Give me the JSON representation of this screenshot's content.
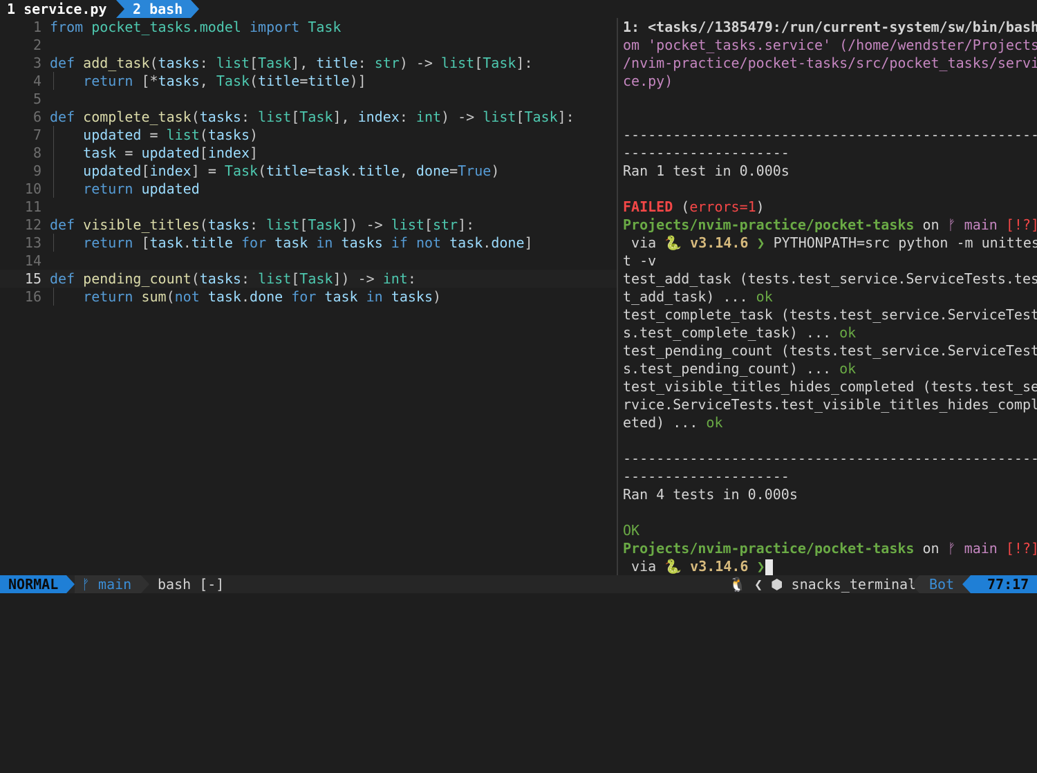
{
  "tabs": [
    {
      "label": "1 service.py"
    },
    {
      "label": "2 bash"
    }
  ],
  "editor": {
    "lines": [
      {
        "num": "1",
        "tokens": [
          [
            "kw",
            "from"
          ],
          [
            "op",
            " "
          ],
          [
            "mod",
            "pocket_tasks.model"
          ],
          [
            "op",
            " "
          ],
          [
            "kw",
            "import"
          ],
          [
            "op",
            " "
          ],
          [
            "ty",
            "Task"
          ]
        ]
      },
      {
        "num": "2",
        "tokens": []
      },
      {
        "num": "3",
        "tokens": [
          [
            "kw",
            "def"
          ],
          [
            "op",
            " "
          ],
          [
            "fn",
            "add_task"
          ],
          [
            "pu",
            "("
          ],
          [
            "va",
            "tasks"
          ],
          [
            "pu",
            ": "
          ],
          [
            "ty",
            "list"
          ],
          [
            "pu",
            "["
          ],
          [
            "ty",
            "Task"
          ],
          [
            "pu",
            "], "
          ],
          [
            "va",
            "title"
          ],
          [
            "pu",
            ": "
          ],
          [
            "ty",
            "str"
          ],
          [
            "pu",
            ") -> "
          ],
          [
            "ty",
            "list"
          ],
          [
            "pu",
            "["
          ],
          [
            "ty",
            "Task"
          ],
          [
            "pu",
            "]:"
          ]
        ]
      },
      {
        "num": "4",
        "guide": true,
        "tokens": [
          [
            "op",
            "    "
          ],
          [
            "kw",
            "return"
          ],
          [
            "op",
            " "
          ],
          [
            "pu",
            "[*"
          ],
          [
            "va",
            "tasks"
          ],
          [
            "pu",
            ", "
          ],
          [
            "ty",
            "Task"
          ],
          [
            "pu",
            "("
          ],
          [
            "va",
            "title"
          ],
          [
            "op",
            "="
          ],
          [
            "va",
            "title"
          ],
          [
            "pu",
            ")]"
          ]
        ]
      },
      {
        "num": "5",
        "tokens": []
      },
      {
        "num": "6",
        "tokens": [
          [
            "kw",
            "def"
          ],
          [
            "op",
            " "
          ],
          [
            "fn",
            "complete_task"
          ],
          [
            "pu",
            "("
          ],
          [
            "va",
            "tasks"
          ],
          [
            "pu",
            ": "
          ],
          [
            "ty",
            "list"
          ],
          [
            "pu",
            "["
          ],
          [
            "ty",
            "Task"
          ],
          [
            "pu",
            "], "
          ],
          [
            "va",
            "index"
          ],
          [
            "pu",
            ": "
          ],
          [
            "ty",
            "int"
          ],
          [
            "pu",
            ") -> "
          ],
          [
            "ty",
            "list"
          ],
          [
            "pu",
            "["
          ],
          [
            "ty",
            "Task"
          ],
          [
            "pu",
            "]:"
          ]
        ]
      },
      {
        "num": "7",
        "guide": true,
        "tokens": [
          [
            "op",
            "    "
          ],
          [
            "va",
            "updated"
          ],
          [
            "op",
            " = "
          ],
          [
            "ty",
            "list"
          ],
          [
            "pu",
            "("
          ],
          [
            "va",
            "tasks"
          ],
          [
            "pu",
            ")"
          ]
        ]
      },
      {
        "num": "8",
        "guide": true,
        "tokens": [
          [
            "op",
            "    "
          ],
          [
            "va",
            "task"
          ],
          [
            "op",
            " = "
          ],
          [
            "va",
            "updated"
          ],
          [
            "pu",
            "["
          ],
          [
            "va",
            "index"
          ],
          [
            "pu",
            "]"
          ]
        ]
      },
      {
        "num": "9",
        "guide": true,
        "tokens": [
          [
            "op",
            "    "
          ],
          [
            "va",
            "updated"
          ],
          [
            "pu",
            "["
          ],
          [
            "va",
            "index"
          ],
          [
            "pu",
            "]"
          ],
          [
            "op",
            " = "
          ],
          [
            "ty",
            "Task"
          ],
          [
            "pu",
            "("
          ],
          [
            "va",
            "title"
          ],
          [
            "op",
            "="
          ],
          [
            "va",
            "task"
          ],
          [
            "pu",
            "."
          ],
          [
            "va",
            "title"
          ],
          [
            "pu",
            ", "
          ],
          [
            "va",
            "done"
          ],
          [
            "op",
            "="
          ],
          [
            "kw",
            "True"
          ],
          [
            "pu",
            ")"
          ]
        ]
      },
      {
        "num": "10",
        "guide": true,
        "tokens": [
          [
            "op",
            "    "
          ],
          [
            "kw",
            "return"
          ],
          [
            "op",
            " "
          ],
          [
            "va",
            "updated"
          ]
        ]
      },
      {
        "num": "11",
        "tokens": []
      },
      {
        "num": "12",
        "tokens": [
          [
            "kw",
            "def"
          ],
          [
            "op",
            " "
          ],
          [
            "fn",
            "visible_titles"
          ],
          [
            "pu",
            "("
          ],
          [
            "va",
            "tasks"
          ],
          [
            "pu",
            ": "
          ],
          [
            "ty",
            "list"
          ],
          [
            "pu",
            "["
          ],
          [
            "ty",
            "Task"
          ],
          [
            "pu",
            "]) -> "
          ],
          [
            "ty",
            "list"
          ],
          [
            "pu",
            "["
          ],
          [
            "ty",
            "str"
          ],
          [
            "pu",
            "]:"
          ]
        ]
      },
      {
        "num": "13",
        "guide": true,
        "tokens": [
          [
            "op",
            "    "
          ],
          [
            "kw",
            "return"
          ],
          [
            "op",
            " "
          ],
          [
            "pu",
            "["
          ],
          [
            "va",
            "task"
          ],
          [
            "pu",
            "."
          ],
          [
            "va",
            "title"
          ],
          [
            "op",
            " "
          ],
          [
            "kw",
            "for"
          ],
          [
            "op",
            " "
          ],
          [
            "va",
            "task"
          ],
          [
            "op",
            " "
          ],
          [
            "kw",
            "in"
          ],
          [
            "op",
            " "
          ],
          [
            "va",
            "tasks"
          ],
          [
            "op",
            " "
          ],
          [
            "kw",
            "if"
          ],
          [
            "op",
            " "
          ],
          [
            "kw",
            "not"
          ],
          [
            "op",
            " "
          ],
          [
            "va",
            "task"
          ],
          [
            "pu",
            "."
          ],
          [
            "va",
            "done"
          ],
          [
            "pu",
            "]"
          ]
        ]
      },
      {
        "num": "14",
        "tokens": []
      },
      {
        "num": "15",
        "current": true,
        "tokens": [
          [
            "kw",
            "def"
          ],
          [
            "op",
            " "
          ],
          [
            "fn",
            "pending_count"
          ],
          [
            "pu",
            "("
          ],
          [
            "va",
            "tasks"
          ],
          [
            "pu",
            ": "
          ],
          [
            "ty",
            "list"
          ],
          [
            "pu",
            "["
          ],
          [
            "ty",
            "Task"
          ],
          [
            "pu",
            "]) -> "
          ],
          [
            "ty",
            "int"
          ],
          [
            "pu",
            ":"
          ]
        ]
      },
      {
        "num": "16",
        "guide": true,
        "tokens": [
          [
            "op",
            "    "
          ],
          [
            "kw",
            "return"
          ],
          [
            "op",
            " "
          ],
          [
            "fn",
            "sum"
          ],
          [
            "pu",
            "("
          ],
          [
            "kw",
            "not"
          ],
          [
            "op",
            " "
          ],
          [
            "va",
            "task"
          ],
          [
            "pu",
            "."
          ],
          [
            "va",
            "done"
          ],
          [
            "op",
            " "
          ],
          [
            "kw",
            "for"
          ],
          [
            "op",
            " "
          ],
          [
            "va",
            "task"
          ],
          [
            "op",
            " "
          ],
          [
            "kw",
            "in"
          ],
          [
            "op",
            " "
          ],
          [
            "va",
            "tasks"
          ],
          [
            "pu",
            ")"
          ]
        ]
      }
    ]
  },
  "terminal": {
    "lines": [
      [
        [
          "t-bold",
          "1: <tasks//1385479:/run/current-system/sw/bin/bash"
        ]
      ],
      [
        [
          "t-pink",
          "om 'pocket_tasks.service' (/home/wendster/Projects"
        ]
      ],
      [
        [
          "t-pink",
          "/nvim-practice/pocket-tasks/src/pocket_tasks/servi"
        ]
      ],
      [
        [
          "t-pink",
          "ce.py)"
        ]
      ],
      [],
      [],
      [
        [
          "",
          "--------------------------------------------------"
        ]
      ],
      [
        [
          "",
          "--------------------"
        ]
      ],
      [
        [
          "",
          "Ran 1 test in 0.000s"
        ]
      ],
      [],
      [
        [
          "t-red",
          "FAILED"
        ],
        [
          "",
          " ("
        ],
        [
          "t-redn",
          "errors=1"
        ],
        [
          "",
          ")"
        ]
      ],
      [
        [
          "t-green",
          "Projects/nvim-practice/pocket-tasks"
        ],
        [
          "",
          " on "
        ],
        [
          "t-pink",
          "ᚠ main"
        ],
        [
          "",
          " "
        ],
        [
          "t-redn",
          "[!?]"
        ]
      ],
      [
        [
          "",
          " via "
        ],
        [
          "t-yellow",
          "🐍 v3.14.6"
        ],
        [
          "",
          " "
        ],
        [
          "t-green",
          "❯"
        ],
        [
          "",
          " PYTHONPATH=src python -m unittes"
        ]
      ],
      [
        [
          "",
          "t -v"
        ]
      ],
      [
        [
          "",
          "test_add_task (tests.test_service.ServiceTests.tes"
        ]
      ],
      [
        [
          "",
          "t_add_task) ... "
        ],
        [
          "t-ok",
          "ok"
        ]
      ],
      [
        [
          "",
          "test_complete_task (tests.test_service.ServiceTest"
        ]
      ],
      [
        [
          "",
          "s.test_complete_task) ... "
        ],
        [
          "t-ok",
          "ok"
        ]
      ],
      [
        [
          "",
          "test_pending_count (tests.test_service.ServiceTest"
        ]
      ],
      [
        [
          "",
          "s.test_pending_count) ... "
        ],
        [
          "t-ok",
          "ok"
        ]
      ],
      [
        [
          "",
          "test_visible_titles_hides_completed (tests.test_se"
        ]
      ],
      [
        [
          "",
          "rvice.ServiceTests.test_visible_titles_hides_compl"
        ]
      ],
      [
        [
          "",
          "eted) ... "
        ],
        [
          "t-ok",
          "ok"
        ]
      ],
      [],
      [
        [
          "",
          "--------------------------------------------------"
        ]
      ],
      [
        [
          "",
          "--------------------"
        ]
      ],
      [
        [
          "",
          "Ran 4 tests in 0.000s"
        ]
      ],
      [],
      [
        [
          "t-greenn",
          "OK"
        ]
      ],
      [
        [
          "t-green",
          "Projects/nvim-practice/pocket-tasks"
        ],
        [
          "",
          " on "
        ],
        [
          "t-pink",
          "ᚠ main"
        ],
        [
          "",
          " "
        ],
        [
          "t-redn",
          "[!?]"
        ]
      ],
      [
        [
          "",
          " via "
        ],
        [
          "t-yellow",
          "🐍 v3.14.6"
        ],
        [
          "",
          " "
        ],
        [
          "t-green",
          "❯"
        ],
        [
          "CURSOR",
          ""
        ]
      ]
    ]
  },
  "statusline": {
    "mode": "NORMAL",
    "branch": "ᚠ main",
    "filename": "bash [-]",
    "right_info": "🐧 ❮ ⬢ snacks_terminal",
    "scroll": "Bot",
    "position": "77:17"
  },
  "colors": {
    "accent": "#1f7fd6",
    "background": "#1e1e1e",
    "keyword": "#569cd6",
    "type": "#4ec9b0",
    "variable": "#9cdcfe",
    "function": "#dcdcaa",
    "error": "#f44747",
    "success": "#6aaa45",
    "path_pink": "#c586c0"
  }
}
